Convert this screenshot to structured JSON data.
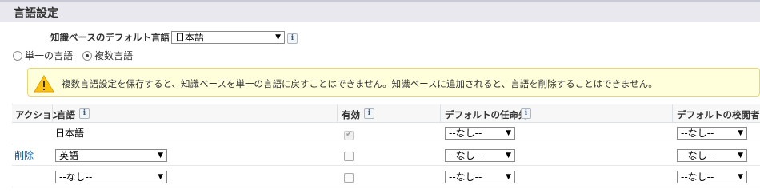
{
  "section": {
    "title": "言語設定"
  },
  "kb_default": {
    "label": "知識ベースのデフォルト言語",
    "value": "日本語"
  },
  "mode": {
    "single_label": "単一の言語",
    "multi_label": "複数言語",
    "selected": "multi"
  },
  "alert": {
    "text": "複数言語設定を保存すると、知識ベースを単一の言語に戻すことはできません。知識ベースに追加されると、言語を削除することはできません。",
    "icon": "warning-icon",
    "color": "#ffc20e"
  },
  "table": {
    "headers": {
      "action": "アクション",
      "language": "言語",
      "active": "有効",
      "assignee": "デフォルトの任命先",
      "reviewer": "デフォルトの校閲者"
    },
    "rows": [
      {
        "action": "",
        "language": "日本語",
        "active_checked": true,
        "active_disabled": true,
        "assignee": "--なし--",
        "reviewer": "--なし--"
      },
      {
        "action": "削除",
        "language": "英語",
        "active_checked": false,
        "active_disabled": false,
        "assignee": "--なし--",
        "reviewer": "--なし--"
      },
      {
        "action": "",
        "language": "--なし--",
        "active_checked": false,
        "active_disabled": false,
        "assignee": "--なし--",
        "reviewer": "--なし--"
      }
    ]
  },
  "info_glyph": "i",
  "dropdown_arrow": "▼"
}
